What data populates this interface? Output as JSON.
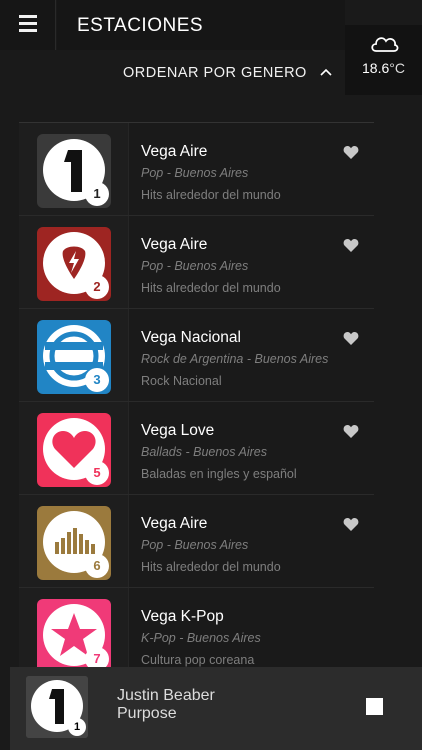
{
  "header": {
    "title": "ESTACIONES",
    "menu_icon": "hamburger-menu-icon"
  },
  "weather": {
    "icon": "cloud-icon",
    "temperature": "18.6",
    "unit": "°C"
  },
  "sort": {
    "label": "ORDENAR POR GENERO",
    "icon": "chevron-up-icon"
  },
  "stations": [
    {
      "name": "Vega Aire",
      "genre": "Pop - Buenos Aires",
      "description": "Hits alrededor del mundo",
      "number": "1",
      "logo_color": "#3a3a3a",
      "logo_icon": "number-one-icon",
      "favorite": true
    },
    {
      "name": "Vega Aire",
      "genre": "Pop - Buenos Aires",
      "description": "Hits alrededor del mundo",
      "number": "2",
      "logo_color": "#9e2522",
      "logo_icon": "guitar-pick-icon",
      "favorite": true
    },
    {
      "name": "Vega Nacional",
      "genre": "Rock de Argentina - Buenos Aires",
      "description": "Rock Nacional",
      "number": "3",
      "logo_color": "#2185c5",
      "logo_icon": "argentina-flag-icon",
      "favorite": true
    },
    {
      "name": "Vega Love",
      "genre": "Ballads - Buenos Aires",
      "description": "Baladas en ingles y español",
      "number": "5",
      "logo_color": "#f0325a",
      "logo_icon": "heart-icon",
      "favorite": true
    },
    {
      "name": "Vega Aire",
      "genre": "Pop - Buenos Aires",
      "description": "Hits alrededor del mundo",
      "number": "6",
      "logo_color": "#9b7a3d",
      "logo_icon": "equalizer-icon",
      "favorite": true
    },
    {
      "name": "Vega K-Pop",
      "genre": "K-Pop - Buenos Aires",
      "description": "Cultura pop coreana",
      "number": "7",
      "logo_color": "#f03a78",
      "logo_icon": "star-icon",
      "favorite": false
    }
  ],
  "player": {
    "artist": "Justin Beaber",
    "album": "Purpose",
    "number": "1",
    "stop_icon": "stop-icon"
  }
}
